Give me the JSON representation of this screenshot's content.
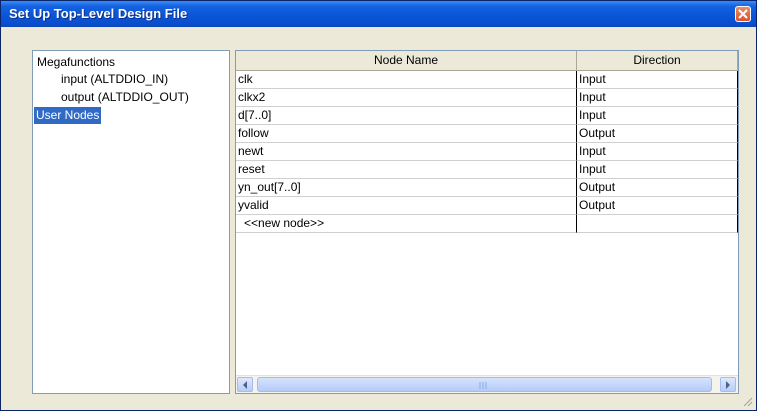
{
  "window": {
    "title": "Set Up Top-Level Design File"
  },
  "tree": {
    "items": [
      {
        "label": "Megafunctions",
        "indent": 0,
        "selected": false
      },
      {
        "label": "input (ALTDDIO_IN)",
        "indent": 1,
        "selected": false
      },
      {
        "label": "output (ALTDDIO_OUT)",
        "indent": 1,
        "selected": false
      },
      {
        "label": "User Nodes",
        "indent": 0,
        "selected": true
      }
    ]
  },
  "table": {
    "columns": [
      "Node Name",
      "Direction"
    ],
    "rows": [
      [
        "clk",
        "Input"
      ],
      [
        "clkx2",
        "Input"
      ],
      [
        "d[7..0]",
        "Input"
      ],
      [
        "follow",
        "Output"
      ],
      [
        "newt",
        "Input"
      ],
      [
        "reset",
        "Input"
      ],
      [
        "yn_out[7..0]",
        "Output"
      ],
      [
        "yvalid",
        "Output"
      ],
      [
        "<<new node>>",
        ""
      ]
    ]
  },
  "colors": {
    "title_bar": "#0a55d8",
    "selection": "#316ac5",
    "dialog_bg": "#ece9d8"
  }
}
